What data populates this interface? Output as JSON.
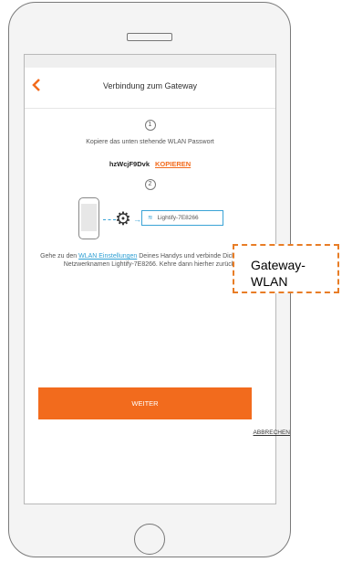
{
  "header": {
    "title": "Verbindung zum Gateway",
    "back_icon": "chevron-left-icon",
    "accent_color": "#f26b1d"
  },
  "steps": {
    "step1": "1",
    "step2": "2"
  },
  "instruction": "Kopiere das unten stehende WLAN Passwort",
  "password": {
    "value": "hzWcjF9Dvk",
    "copy_label": "KOPIEREN"
  },
  "illustration": {
    "network_name": "Lightify-7E8266",
    "wifi_icon": "wifi-icon",
    "gear_icon": "gear-icon"
  },
  "description": {
    "before": "Gehe zu den ",
    "link": "WLAN Einstellungen",
    "after": " Deines Handys und verbinde Dich mit dem Netzwerknamen Lightify-7E8266. Kehre dann hierher zurück."
  },
  "buttons": {
    "next_label": "WEITER",
    "cancel_label": "ABBRECHEN"
  },
  "callout": {
    "text": "Gateway-WLAN",
    "border_color": "#e87d26"
  }
}
